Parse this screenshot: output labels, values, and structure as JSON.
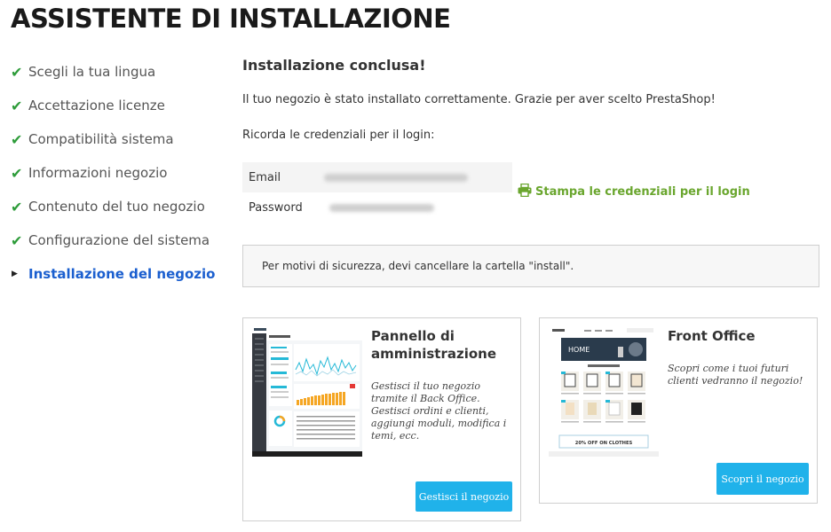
{
  "header": {
    "title": "ASSISTENTE DI INSTALLAZIONE"
  },
  "steps": [
    {
      "label": "Scegli la tua lingua",
      "status": "done"
    },
    {
      "label": "Accettazione licenze",
      "status": "done"
    },
    {
      "label": "Compatibilità sistema",
      "status": "done"
    },
    {
      "label": "Informazioni negozio",
      "status": "done"
    },
    {
      "label": "Contenuto del tuo negozio",
      "status": "done"
    },
    {
      "label": "Configurazione del sistema",
      "status": "done"
    },
    {
      "label": "Installazione del negozio",
      "status": "current"
    }
  ],
  "main": {
    "heading": "Installazione conclusa!",
    "success_text": "Il tuo negozio è stato installato correttamente. Grazie per aver scelto PrestaShop!",
    "remember_text": "Ricorda le credenziali per il login:",
    "credentials": {
      "email_label": "Email",
      "password_label": "Password"
    },
    "print_link": "Stampa le credenziali per il login",
    "security_alert": "Per motivi di sicurezza, devi cancellare la cartella \"install\".",
    "cards": {
      "admin": {
        "title": "Pannello di amministrazione",
        "description": "Gestisci il tuo negozio tramite il Back Office. Gestisci ordini e clienti, aggiungi moduli, modifica i temi, ecc.",
        "button": "Gestisci il negozio"
      },
      "front": {
        "title": "Front Office",
        "description": "Scopri come i tuoi futuri clienti vedranno il negozio!",
        "button": "Scopri il negozio",
        "thumb_hero_text": "HOME",
        "thumb_banner_text": "20% OFF ON CLOTHES"
      }
    }
  },
  "colors": {
    "check": "#2e9c3a",
    "active_step": "#1b5fcf",
    "print_link": "#6aa62e",
    "button": "#20b2ea"
  },
  "icons": {
    "done": "check-icon",
    "current": "triangle-right-icon",
    "print": "printer-icon"
  }
}
